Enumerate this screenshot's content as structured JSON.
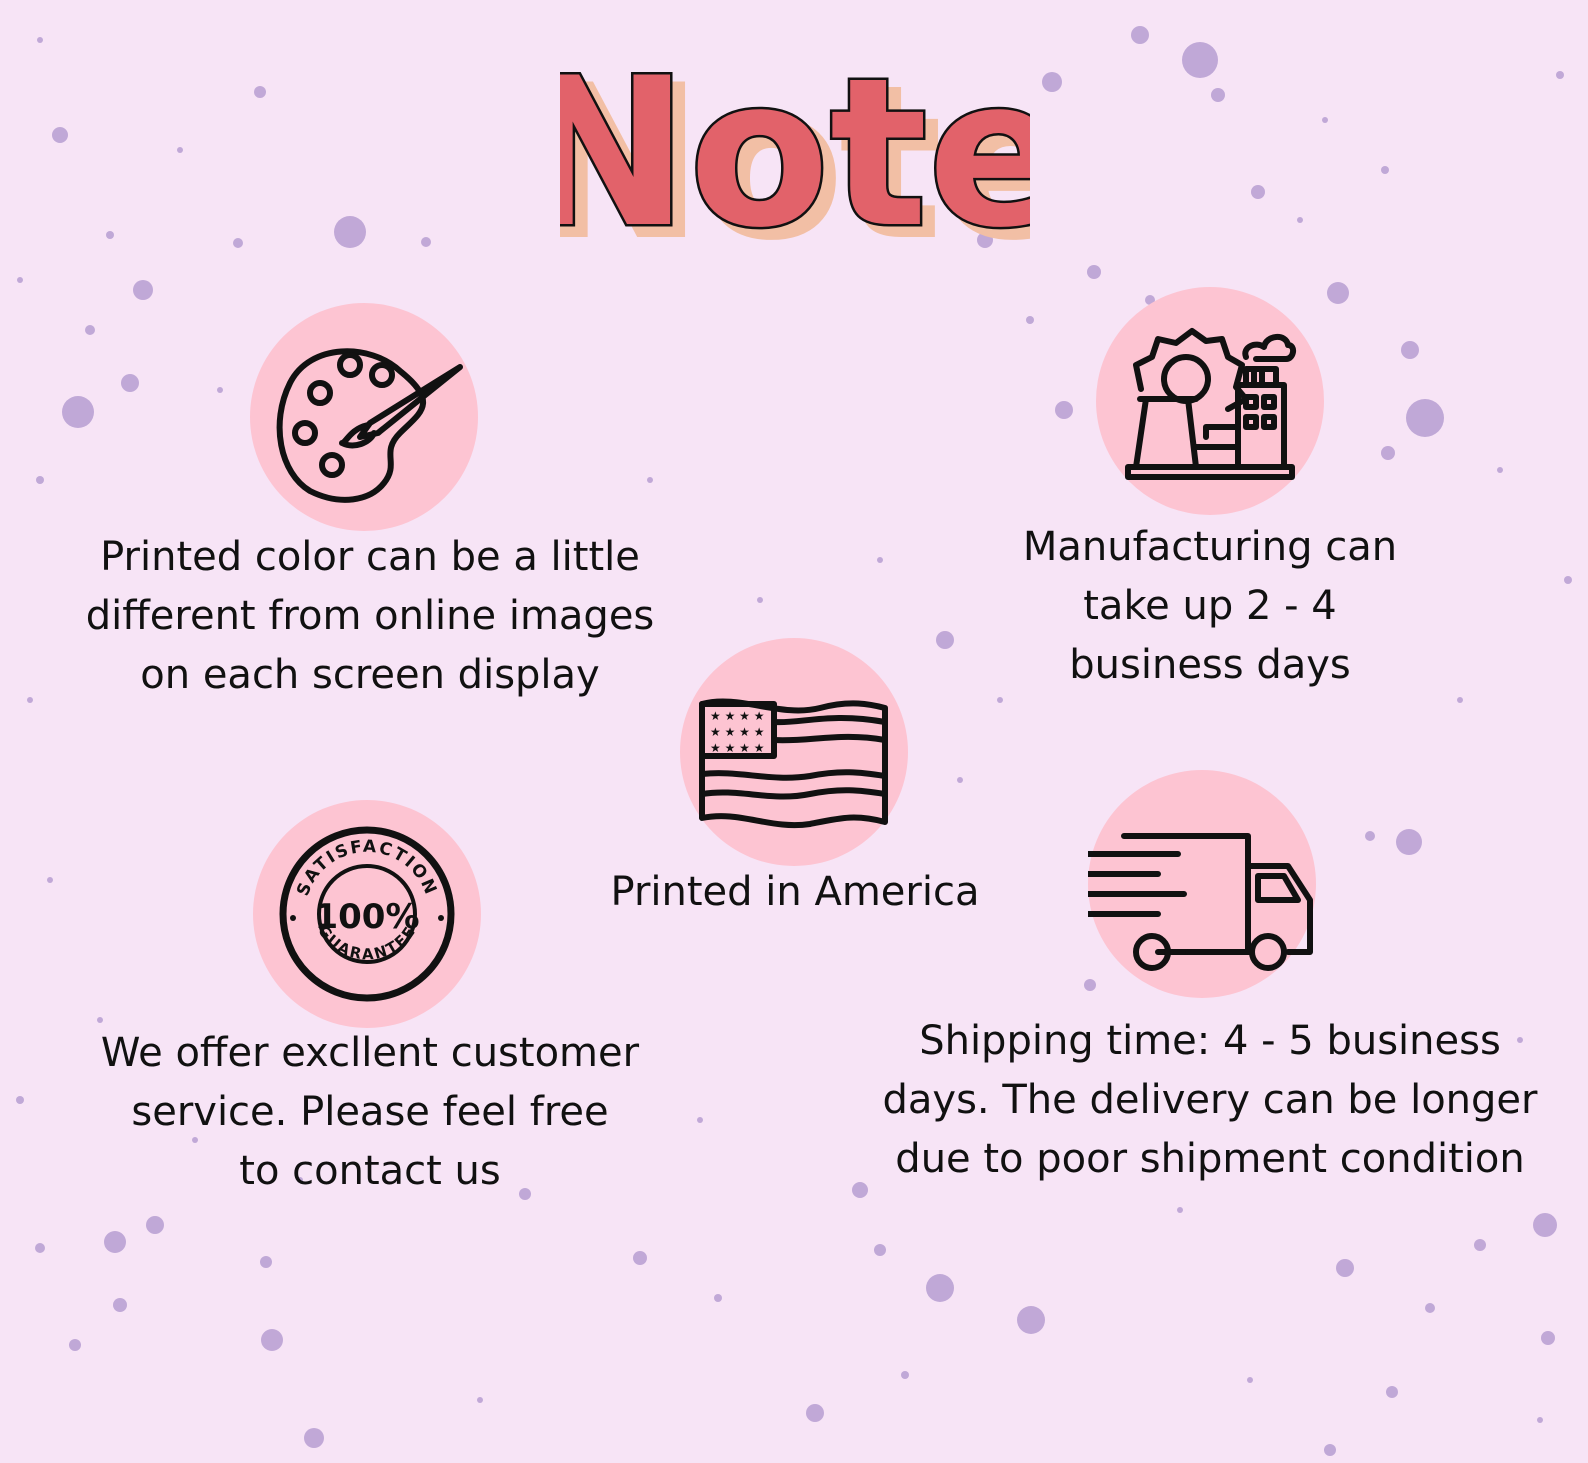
{
  "title": "Note",
  "colors": {
    "background": "#f7e4f6",
    "splatter": "#a98fca",
    "circle": "#fdc4d2",
    "title_fill": "#e2626a",
    "title_shadow": "#f2bfa5",
    "icon_stroke": "#111111"
  },
  "features": [
    {
      "icon": "palette-icon",
      "text": "Printed color can be a little\ndifferent from online images\non each screen display"
    },
    {
      "icon": "factory-icon",
      "text": "Manufacturing can\ntake up 2 - 4\nbusiness days"
    },
    {
      "icon": "american-flag-icon",
      "text": "Printed in America"
    },
    {
      "icon": "satisfaction-badge-icon",
      "text": "We offer excllent customer\nservice. Please feel free\nto contact us",
      "badge_top": "SATISFACTION",
      "badge_center": "100%",
      "badge_bottom": "GUARANTEE"
    },
    {
      "icon": "delivery-truck-icon",
      "text": "Shipping time: 4 - 5 business\ndays. The delivery can be longer\ndue to poor shipment condition"
    }
  ]
}
